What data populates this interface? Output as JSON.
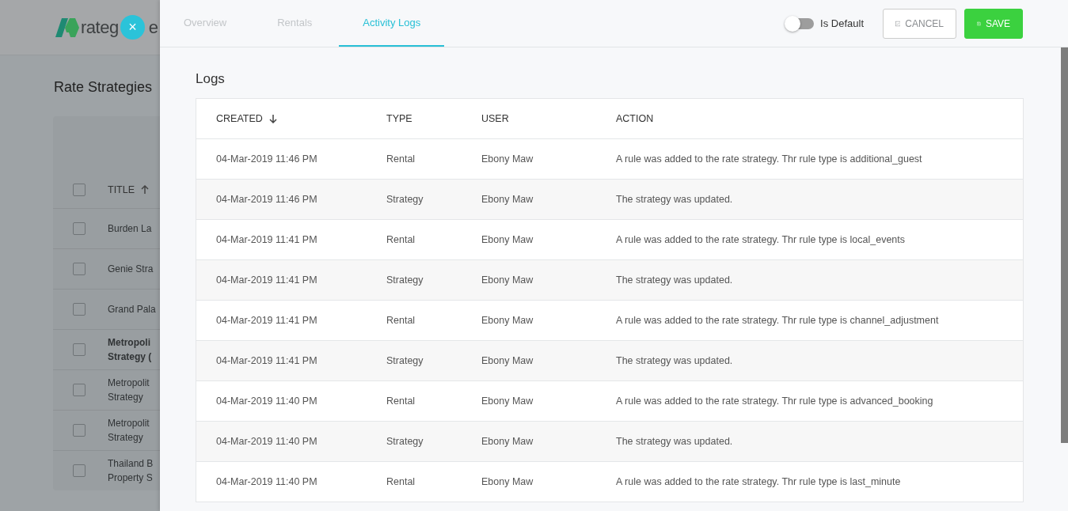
{
  "background": {
    "logo_parts": [
      "rateg",
      "e"
    ],
    "title": "Rate Strategies",
    "table": {
      "header": {
        "label": "TITLE",
        "checked": false
      },
      "rows": [
        {
          "lines": [
            "Burden La"
          ],
          "bold": false,
          "checked": false
        },
        {
          "lines": [
            "Genie Stra"
          ],
          "bold": false,
          "checked": false
        },
        {
          "lines": [
            "Grand Pala"
          ],
          "bold": false,
          "checked": false
        },
        {
          "lines": [
            "Metropoli",
            "Strategy ("
          ],
          "bold": true,
          "checked": false
        },
        {
          "lines": [
            "Metropolit",
            "Strategy"
          ],
          "bold": false,
          "checked": false
        },
        {
          "lines": [
            "Metropolit",
            "Strategy"
          ],
          "bold": false,
          "checked": false
        },
        {
          "lines": [
            "Thailand B",
            "Property S"
          ],
          "bold": false,
          "checked": false
        }
      ]
    }
  },
  "close_button": {
    "label": "×"
  },
  "panel": {
    "tabs": [
      {
        "label": "Overview",
        "selected": false
      },
      {
        "label": "Rentals",
        "selected": false
      },
      {
        "label": "Activity Logs",
        "selected": true
      }
    ],
    "toggle": {
      "label": "Is Default",
      "on": false
    },
    "buttons": [
      {
        "label": "CANCEL",
        "kind": "outline"
      },
      {
        "label": "SAVE",
        "kind": "primary"
      }
    ],
    "logs": {
      "title": "Logs",
      "columns": [
        "CREATED",
        "TYPE",
        "USER",
        "ACTION"
      ],
      "rows": [
        [
          "04-Mar-2019 11:46 PM",
          "Rental",
          "Ebony Maw",
          "A rule was added to the rate strategy. Thr rule type is additional_guest"
        ],
        [
          "04-Mar-2019 11:46 PM",
          "Strategy",
          "Ebony Maw",
          "The strategy was updated."
        ],
        [
          "04-Mar-2019 11:41 PM",
          "Rental",
          "Ebony Maw",
          "A rule was added to the rate strategy. Thr rule type is local_events"
        ],
        [
          "04-Mar-2019 11:41 PM",
          "Strategy",
          "Ebony Maw",
          "The strategy was updated."
        ],
        [
          "04-Mar-2019 11:41 PM",
          "Rental",
          "Ebony Maw",
          "A rule was added to the rate strategy. Thr rule type is channel_adjustment"
        ],
        [
          "04-Mar-2019 11:41 PM",
          "Strategy",
          "Ebony Maw",
          "The strategy was updated."
        ],
        [
          "04-Mar-2019 11:40 PM",
          "Rental",
          "Ebony Maw",
          "A rule was added to the rate strategy. Thr rule type is advanced_booking"
        ],
        [
          "04-Mar-2019 11:40 PM",
          "Strategy",
          "Ebony Maw",
          "The strategy was updated."
        ],
        [
          "04-Mar-2019 11:40 PM",
          "Rental",
          "Ebony Maw",
          "A rule was added to the rate strategy. Thr rule type is last_minute"
        ]
      ]
    }
  }
}
